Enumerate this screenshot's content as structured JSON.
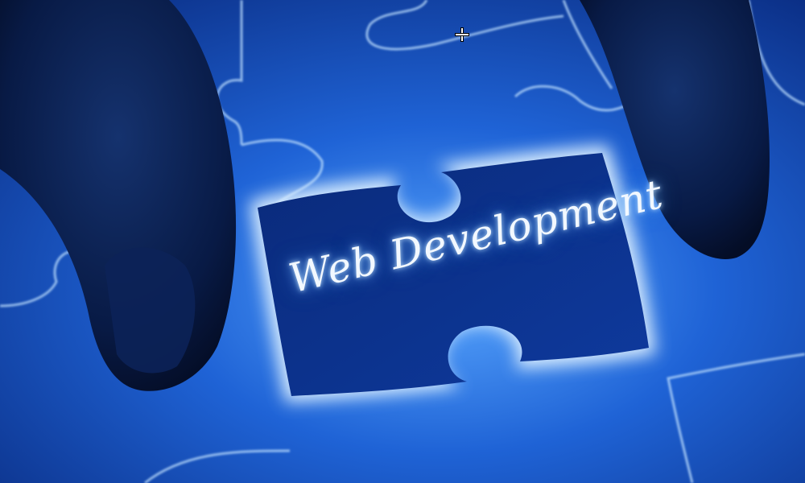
{
  "photo": {
    "caption": "Web Development",
    "palette": {
      "background": "#1a5fd1",
      "piece_face": "#1c56c8",
      "missing_piece": "#0b2f8a",
      "glow": "#e9f6ff",
      "fingers": "#071737"
    }
  },
  "cursor": {
    "icon": "crosshair-icon"
  }
}
